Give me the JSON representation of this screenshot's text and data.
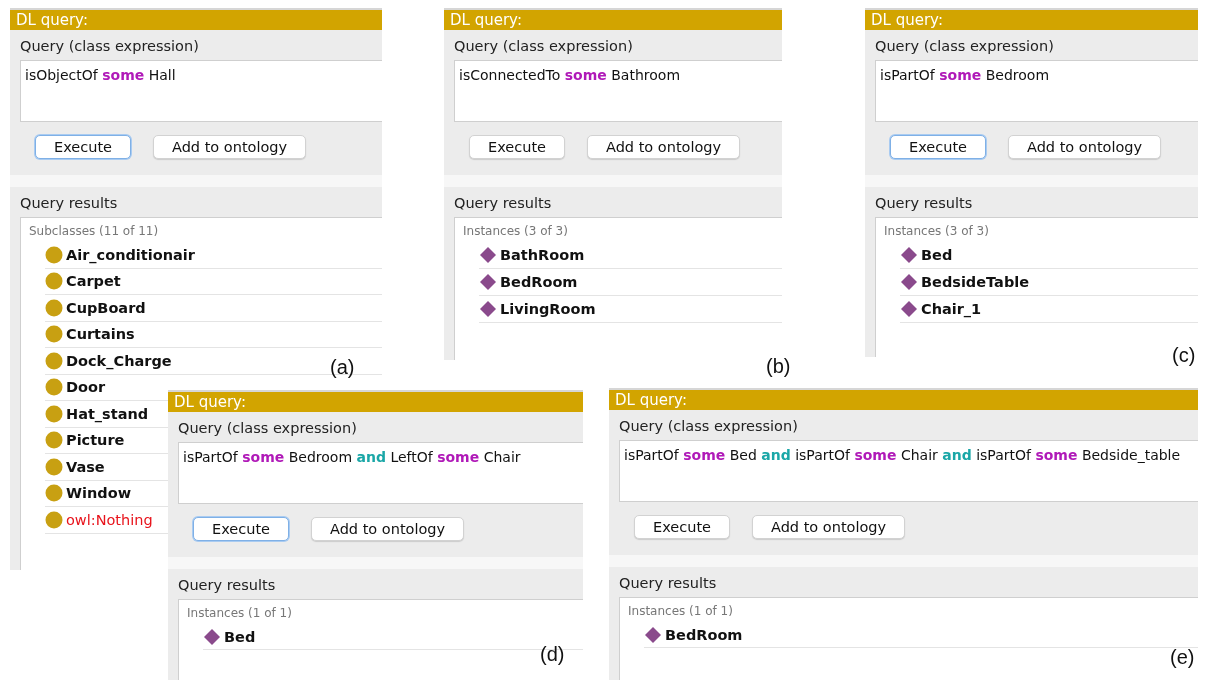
{
  "panels": [
    {
      "caption": "(a)",
      "title": "DL query:",
      "query_label": "Query (class expression)",
      "query": [
        {
          "kind": "text",
          "text": "isObjectOf"
        },
        {
          "kind": "quantifier",
          "text": "some"
        },
        {
          "kind": "text",
          "text": "Hall"
        }
      ],
      "buttons": [
        {
          "label": "Execute",
          "focused": true
        },
        {
          "label": "Add to ontology",
          "focused": false
        }
      ],
      "results_label": "Query results",
      "results_header": "Subclasses (11 of 11)",
      "results": [
        {
          "kind": "class",
          "label": "Air_conditionair"
        },
        {
          "kind": "class",
          "label": "Carpet"
        },
        {
          "kind": "class",
          "label": "CupBoard"
        },
        {
          "kind": "class",
          "label": "Curtains"
        },
        {
          "kind": "class",
          "label": "Dock_Charge"
        },
        {
          "kind": "class",
          "label": "Door"
        },
        {
          "kind": "class",
          "label": "Hat_stand"
        },
        {
          "kind": "class",
          "label": "Picture"
        },
        {
          "kind": "class",
          "label": "Vase"
        },
        {
          "kind": "class",
          "label": "Window"
        },
        {
          "kind": "nothing",
          "label": "owl:Nothing"
        }
      ]
    },
    {
      "caption": "(b)",
      "title": "DL query:",
      "query_label": "Query (class expression)",
      "query": [
        {
          "kind": "text",
          "text": "isConnectedTo"
        },
        {
          "kind": "quantifier",
          "text": "some"
        },
        {
          "kind": "text",
          "text": "Bathroom"
        }
      ],
      "buttons": [
        {
          "label": "Execute",
          "focused": false
        },
        {
          "label": "Add to ontology",
          "focused": false
        }
      ],
      "results_label": "Query results",
      "results_header": "Instances (3 of 3)",
      "results": [
        {
          "kind": "individual",
          "label": "BathRoom"
        },
        {
          "kind": "individual",
          "label": "BedRoom"
        },
        {
          "kind": "individual",
          "label": "LivingRoom"
        }
      ]
    },
    {
      "caption": "(c)",
      "title": "DL query:",
      "query_label": "Query (class expression)",
      "query": [
        {
          "kind": "text",
          "text": "isPartOf"
        },
        {
          "kind": "quantifier",
          "text": "some"
        },
        {
          "kind": "text",
          "text": "Bedroom"
        }
      ],
      "buttons": [
        {
          "label": "Execute",
          "focused": true
        },
        {
          "label": "Add to ontology",
          "focused": false
        }
      ],
      "results_label": "Query results",
      "results_header": "Instances (3 of 3)",
      "results": [
        {
          "kind": "individual",
          "label": "Bed"
        },
        {
          "kind": "individual",
          "label": "BedsideTable"
        },
        {
          "kind": "individual",
          "label": "Chair_1"
        }
      ]
    },
    {
      "caption": "(d)",
      "title": "DL query:",
      "query_label": "Query (class expression)",
      "query": [
        {
          "kind": "text",
          "text": "isPartOf"
        },
        {
          "kind": "quantifier",
          "text": "some"
        },
        {
          "kind": "text",
          "text": "Bedroom"
        },
        {
          "kind": "connective",
          "text": "and"
        },
        {
          "kind": "text",
          "text": "LeftOf"
        },
        {
          "kind": "quantifier",
          "text": "some"
        },
        {
          "kind": "text",
          "text": "Chair"
        }
      ],
      "buttons": [
        {
          "label": "Execute",
          "focused": true
        },
        {
          "label": "Add to ontology",
          "focused": false
        }
      ],
      "results_label": "Query results",
      "results_header": "Instances (1 of 1)",
      "results": [
        {
          "kind": "individual",
          "label": "Bed"
        }
      ]
    },
    {
      "caption": "(e)",
      "title": "DL query:",
      "query_label": "Query (class expression)",
      "query": [
        {
          "kind": "text",
          "text": "isPartOf"
        },
        {
          "kind": "quantifier",
          "text": "some"
        },
        {
          "kind": "text",
          "text": "Bed"
        },
        {
          "kind": "connective",
          "text": "and"
        },
        {
          "kind": "text",
          "text": "isPartOf"
        },
        {
          "kind": "quantifier",
          "text": "some"
        },
        {
          "kind": "text",
          "text": "Chair"
        },
        {
          "kind": "connective",
          "text": "and"
        },
        {
          "kind": "text",
          "text": "isPartOf"
        },
        {
          "kind": "quantifier",
          "text": "some"
        },
        {
          "kind": "text",
          "text": "Bedside_table"
        }
      ],
      "buttons": [
        {
          "label": "Execute",
          "focused": false
        },
        {
          "label": "Add to ontology",
          "focused": false
        }
      ],
      "results_label": "Query results",
      "results_header": "Instances (1 of 1)",
      "results": [
        {
          "kind": "individual",
          "label": "BedRoom"
        }
      ]
    }
  ]
}
